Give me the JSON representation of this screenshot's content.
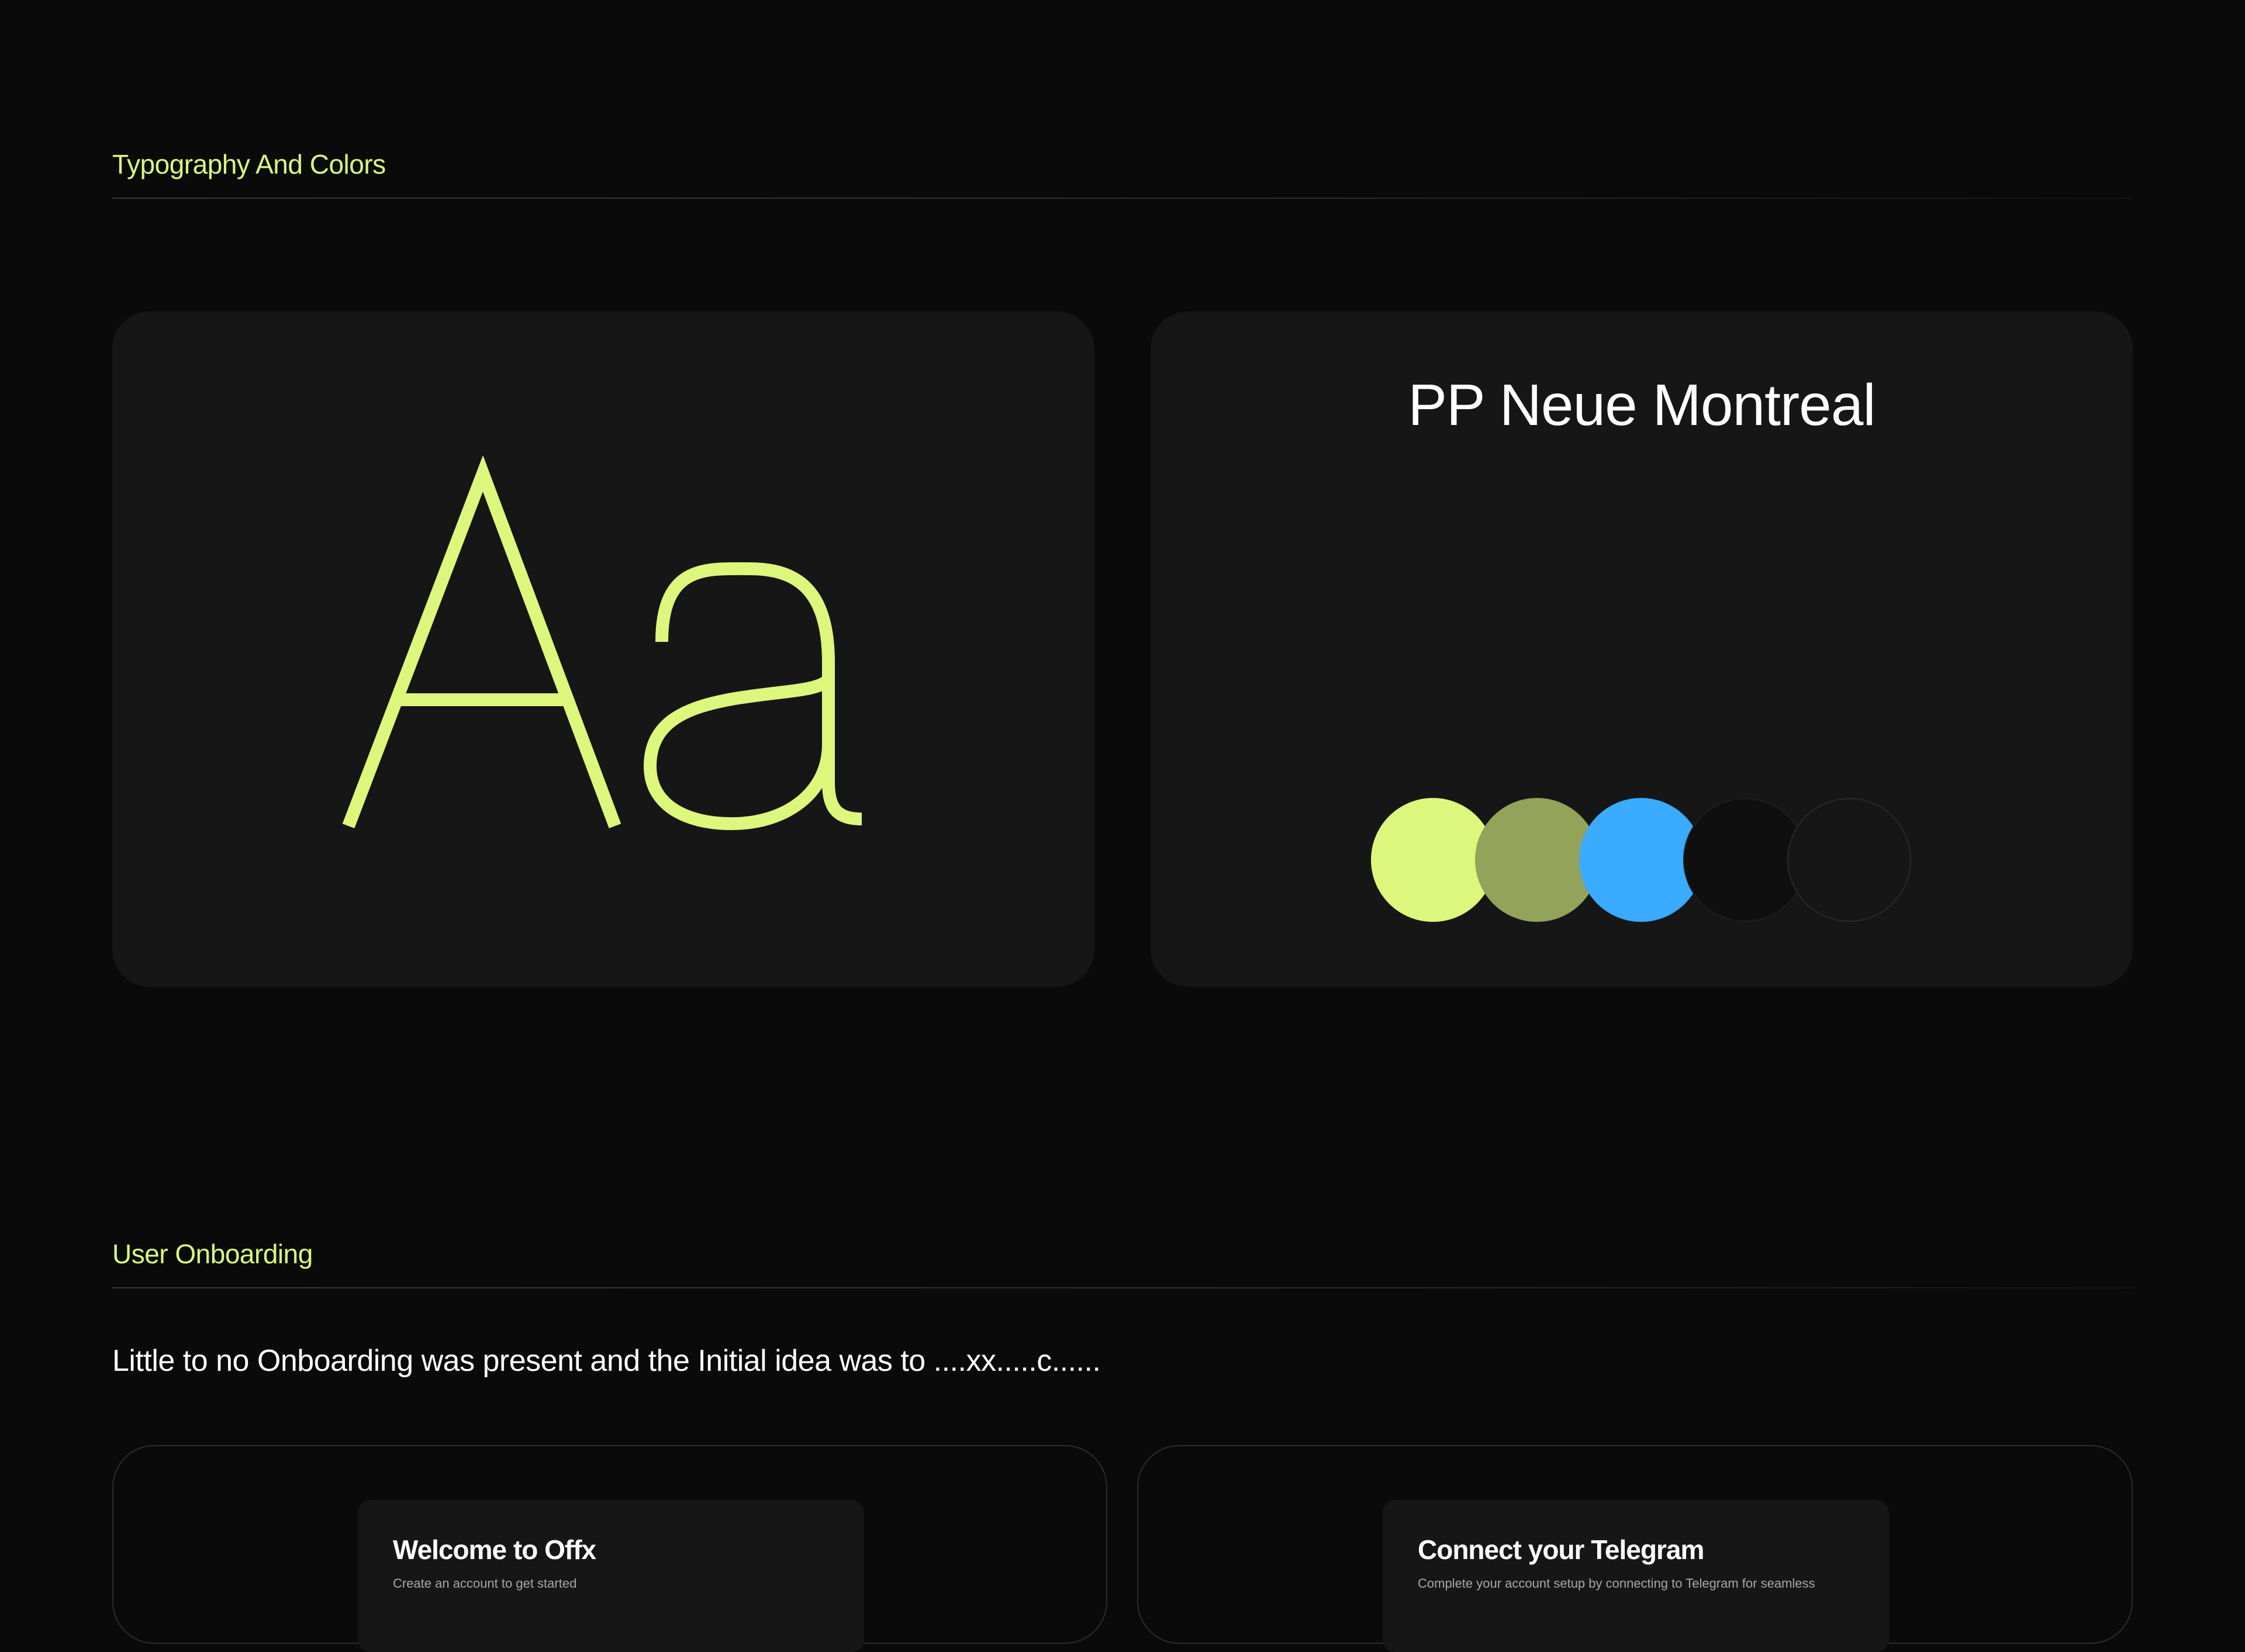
{
  "typography_section": {
    "title": "Typography And Colors",
    "specimen_glyph": "Aa",
    "font_name": "PP Neue Montreal",
    "palette": [
      {
        "name": "lime",
        "hex": "#dcf77c"
      },
      {
        "name": "olive",
        "hex": "#93a35a"
      },
      {
        "name": "blue",
        "hex": "#3aabff"
      },
      {
        "name": "near-black",
        "hex": "#0f0f10"
      },
      {
        "name": "dark-gray",
        "hex": "#161617"
      }
    ]
  },
  "onboarding_section": {
    "title": "User Onboarding",
    "intro": "Little to no Onboarding was present and the Initial idea was to ....xx.....c......",
    "screens": [
      {
        "title": "Welcome to Offx",
        "subtitle": "Create an account to get started"
      },
      {
        "title": "Connect your Telegram",
        "subtitle": "Complete your account setup by connecting to Telegram for seamless"
      }
    ]
  },
  "colors": {
    "background": "#0a0a0a",
    "card": "#161617",
    "accent": "#dcf77c",
    "text": "#ffffff"
  }
}
